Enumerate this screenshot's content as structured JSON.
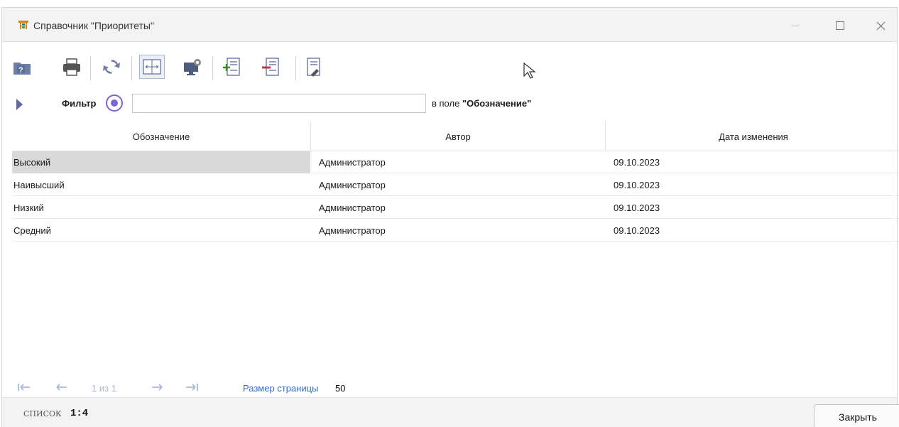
{
  "window": {
    "title": "Справочник \"Приоритеты\""
  },
  "toolbar": {
    "buttons": [
      {
        "name": "help-folder",
        "icon": "folder-question-icon"
      },
      {
        "name": "print",
        "icon": "printer-icon"
      },
      {
        "name": "refresh",
        "icon": "refresh-icon"
      },
      {
        "name": "fit-columns",
        "icon": "fit-columns-icon",
        "active": true
      },
      {
        "name": "monitor-settings",
        "icon": "monitor-gear-icon"
      },
      {
        "name": "add-record",
        "icon": "add-document-icon"
      },
      {
        "name": "delete-record",
        "icon": "remove-document-icon"
      },
      {
        "name": "edit-record",
        "icon": "edit-document-icon"
      }
    ]
  },
  "filter": {
    "label": "Фильтр",
    "value": "",
    "field_prefix": "в поле ",
    "field_name": "\"Обозначение\""
  },
  "grid": {
    "columns": [
      "Обозначение",
      "Автор",
      "Дата изменения"
    ],
    "rows": [
      [
        "Высокий",
        "Администратор",
        "09.10.2023"
      ],
      [
        "Наивысший",
        "Администратор",
        "09.10.2023"
      ],
      [
        "Низкий",
        "Администратор",
        "09.10.2023"
      ],
      [
        "Средний",
        "Администратор",
        "09.10.2023"
      ]
    ],
    "selected_row": 0
  },
  "pager": {
    "page_info": "1 из 1",
    "page_size_label": "Размер страницы",
    "page_size": "50"
  },
  "status": {
    "mode": "СПИСОК",
    "count": "1:4"
  },
  "close_label": "Закрыть",
  "colors": {
    "accent": "#7d62d8",
    "link": "#2f6bd0",
    "selected_row": "#d9d9d9",
    "pager_disabled": "#a6b7d7"
  }
}
